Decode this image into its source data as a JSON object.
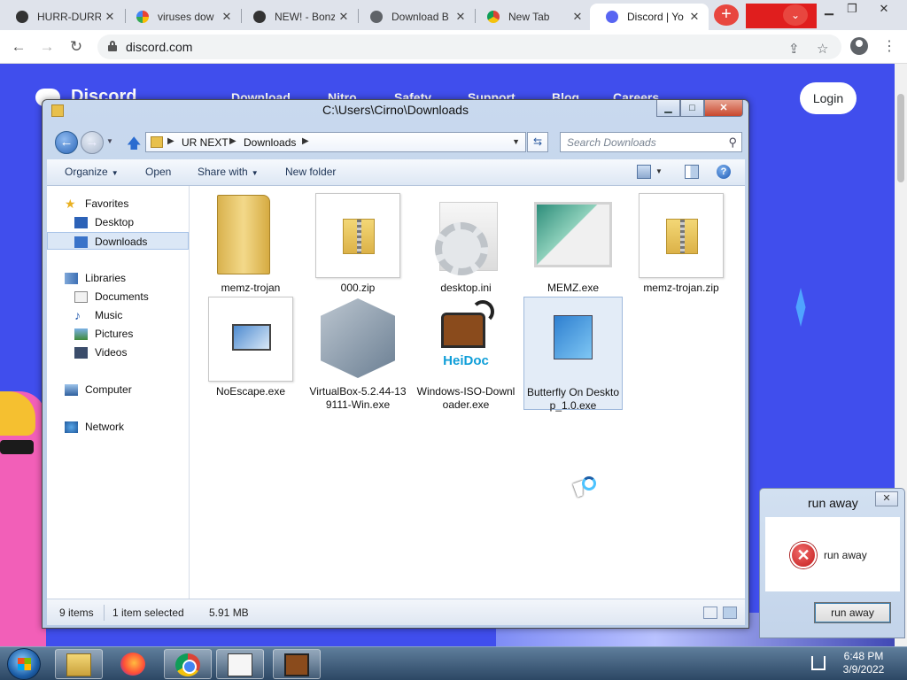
{
  "browser": {
    "tabs": [
      {
        "title": "HURR-DURR",
        "favicon": "github-icon"
      },
      {
        "title": "viruses dow",
        "favicon": "google-icon"
      },
      {
        "title": "NEW! - Bonz",
        "favicon": "github-icon"
      },
      {
        "title": "Download B",
        "favicon": "globe-icon"
      },
      {
        "title": "New Tab",
        "favicon": "chrome-icon"
      },
      {
        "title": "Discord | Yo",
        "favicon": "discord-icon",
        "active": true
      }
    ],
    "new_tab_glyph": "+",
    "url": "discord.com"
  },
  "discord_page": {
    "brand": "Discord",
    "nav_links": [
      "Download",
      "Nitro",
      "Safety",
      "Support",
      "Blog",
      "Careers"
    ],
    "login_label": "Login",
    "accent_color": "#404eed"
  },
  "explorer": {
    "title": "C:\\Users\\Cirno\\Downloads",
    "breadcrumbs": [
      "UR NEXT",
      "Downloads"
    ],
    "search_placeholder": "Search Downloads",
    "toolbar": {
      "organize": "Organize",
      "open": "Open",
      "share_with": "Share with",
      "new_folder": "New folder"
    },
    "nav": {
      "favorites": "Favorites",
      "desktop": "Desktop",
      "downloads": "Downloads",
      "libraries": "Libraries",
      "documents": "Documents",
      "music": "Music",
      "pictures": "Pictures",
      "videos": "Videos",
      "computer": "Computer",
      "network": "Network"
    },
    "files": [
      {
        "name": "memz-trojan",
        "icon": "folder-icon"
      },
      {
        "name": "000.zip",
        "icon": "zip-folder-icon"
      },
      {
        "name": "desktop.ini",
        "icon": "settings-file-icon"
      },
      {
        "name": "MEMZ.exe",
        "icon": "memz-thumbnail"
      },
      {
        "name": "memz-trojan.zip",
        "icon": "zip-folder-icon"
      },
      {
        "name": "NoEscape.exe",
        "icon": "monitor-app-icon"
      },
      {
        "name": "VirtualBox-5.2.44-139111-Win.exe",
        "icon": "virtualbox-icon"
      },
      {
        "name": "Windows-ISO-Downloader.exe",
        "icon": "heidoc-icon"
      },
      {
        "name": "Butterfly On Desktop_1.0.exe",
        "icon": "installer-icon",
        "selected": true
      }
    ],
    "heidoc_logo_text": "HeiDoc",
    "status": {
      "items": "9 items",
      "selected": "1 item selected",
      "size": "5.91 MB"
    }
  },
  "dialog": {
    "title": "run away",
    "message": "run away",
    "button": "run away"
  },
  "taskbar": {
    "time": "6:48 PM",
    "date": "3/9/2022"
  }
}
